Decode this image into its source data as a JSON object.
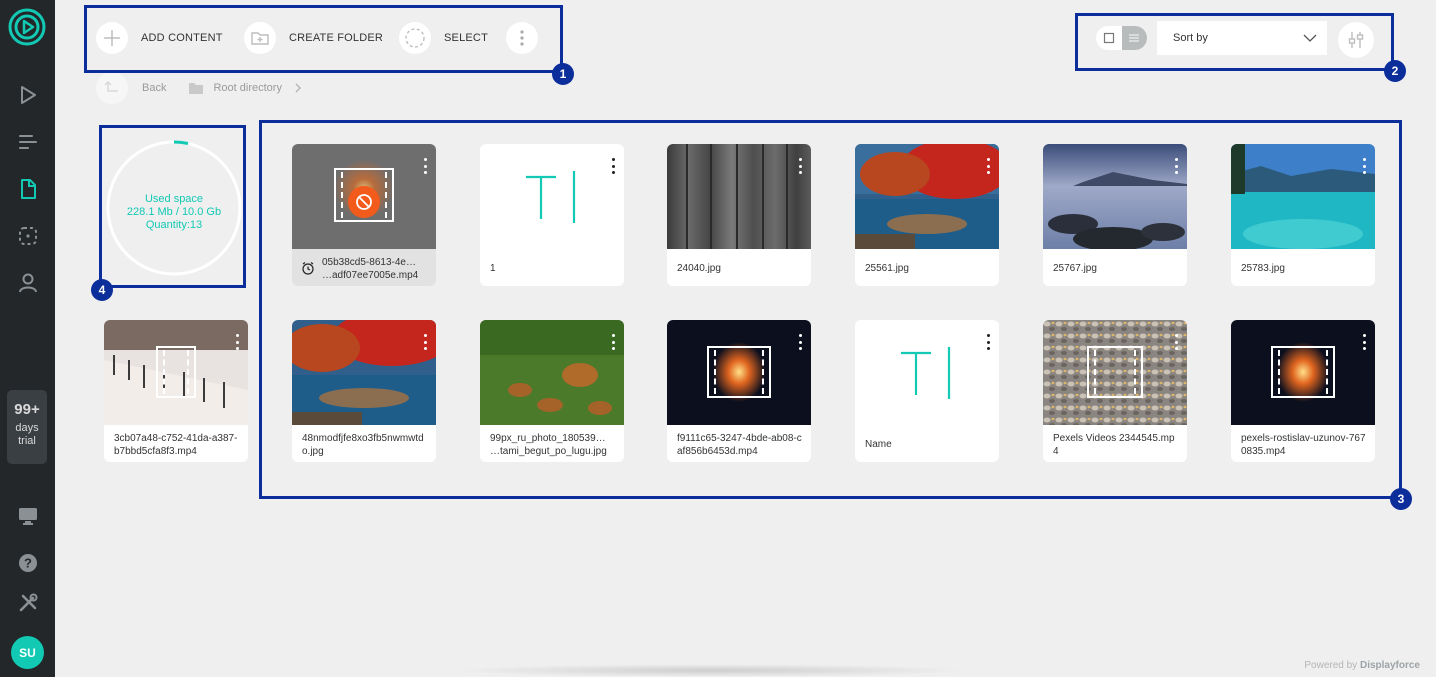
{
  "sidebar": {
    "trial_count": "99+",
    "trial_unit": "days",
    "trial_label": "trial",
    "avatar_initials": "SU",
    "accent": "#12c9b4"
  },
  "toolbar": {
    "add_content": "ADD CONTENT",
    "create_folder": "CREATE FOLDER",
    "select": "SELECT"
  },
  "breadcrumb": {
    "back": "Back",
    "root": "Root directory"
  },
  "sort": {
    "label": "Sort by"
  },
  "storage": {
    "title": "Used space",
    "usage": "228.1 Mb / 10.0 Gb",
    "quantity": "Quantity:13"
  },
  "files": [
    {
      "name_line1": "05b38cd5-8613-4e…",
      "name_line2": "…adf07ee7005e.mp4",
      "kind": "video-blocked",
      "status_icon": "alarm-clock-icon"
    },
    {
      "name": "1",
      "kind": "text"
    },
    {
      "name": "24040.jpg",
      "kind": "image"
    },
    {
      "name": "25561.jpg",
      "kind": "image"
    },
    {
      "name": "25767.jpg",
      "kind": "image"
    },
    {
      "name": "25783.jpg",
      "kind": "image"
    },
    {
      "name": "3cb07a48-c752-41da-a387-b7bbd5cfa8f3.mp4",
      "kind": "video"
    },
    {
      "name": "48nmodfjfe8xo3fb5nwmwtdo.jpg",
      "kind": "image"
    },
    {
      "name_line1": "99px_ru_photo_180539…",
      "name_line2": "…tami_begut_po_lugu.jpg",
      "kind": "image"
    },
    {
      "name": "f9111c65-3247-4bde-ab08-caf856b6453d.mp4",
      "kind": "video"
    },
    {
      "name": "Name",
      "kind": "text"
    },
    {
      "name": "Pexels Videos 2344545.mp4",
      "kind": "video"
    },
    {
      "name": "pexels-rostislav-uzunov-7670835.mp4",
      "kind": "video"
    }
  ],
  "annotations": [
    "1",
    "2",
    "3",
    "4"
  ],
  "footer": {
    "powered_prefix": "Powered by ",
    "brand": "Displayforce"
  }
}
